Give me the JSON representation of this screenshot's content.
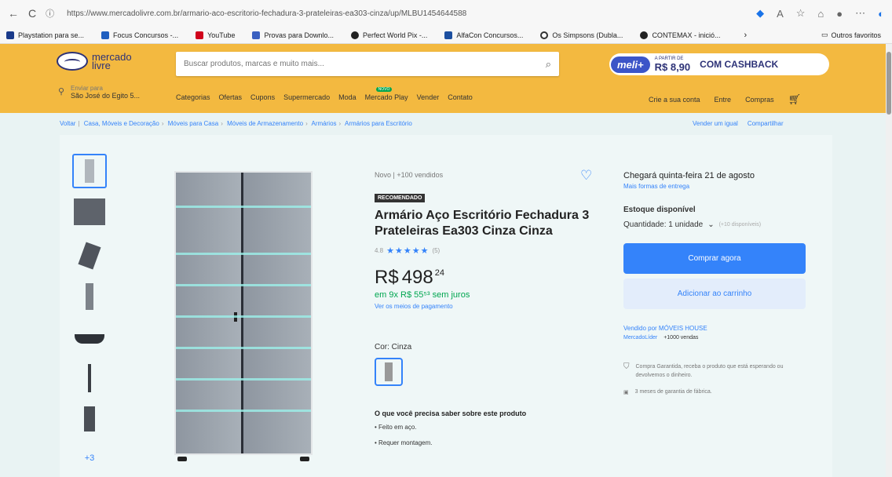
{
  "browser": {
    "url": "https://www.mercadolivre.com.br/armario-aco-escritorio-fechadura-3-prateleiras-ea303-cinza/up/MLBU1454644588",
    "bookmarks": [
      {
        "label": "Playstation para se...",
        "color": "#1a3a8a"
      },
      {
        "label": "Focus Concursos -...",
        "color": "#2060c0"
      },
      {
        "label": "YouTube",
        "color": "#d0021b"
      },
      {
        "label": "Provas para Downlo...",
        "color": "#3a60c0"
      },
      {
        "label": "Perfect World Pix -...",
        "color": "#222222"
      },
      {
        "label": "AlfaCon Concursos...",
        "color": "#1c4fa0"
      },
      {
        "label": "Os Simpsons (Dubla...",
        "color": "#333333"
      },
      {
        "label": "CONTEMAX - inició...",
        "color": "#222222"
      }
    ],
    "others": "Outros favoritos"
  },
  "header": {
    "logo_text": "mercado livre",
    "search_placeholder": "Buscar produtos, marcas e muito mais...",
    "promo": {
      "brand": "meli+",
      "price_label": "A PARTIR DE",
      "price": "R$ 8,90",
      "cashback": "COM CASHBACK"
    },
    "location": {
      "line1": "Enviar para",
      "line2": "São José do Egito 5..."
    },
    "menu": [
      "Categorias",
      "Ofertas",
      "Cupons",
      "Supermercado",
      "Moda",
      "Mercado Play",
      "Vender",
      "Contato"
    ],
    "user_menu": [
      "Crie a sua conta",
      "Entre",
      "Compras"
    ]
  },
  "breadcrumbs": [
    "Voltar",
    "Casa, Móveis e Decoração",
    "Móveis para Casa",
    "Móveis de Armazenamento",
    "Armários",
    "Armários para Escritório"
  ],
  "breadcrumb_right": [
    "Vender um igual",
    "Compartilhar"
  ],
  "product": {
    "condition": "Novo  |  +100 vendidos",
    "badge": "RECOMENDADO",
    "title": "Armário Aço Escritório Fechadura 3 Prateleiras Ea303 Cinza Cinza",
    "rating": "4.8",
    "stars": "★★★★★",
    "reviews": "(5)",
    "price_currency": "R$",
    "price_amount": "498",
    "price_cents": "24",
    "installments": "em 9x R$ 55⁵³ sem juros",
    "payment_link": "Ver os meios de pagamento",
    "color_label": "Cor: Cinza",
    "know_title": "O que você precisa saber sobre este produto",
    "know_items": [
      "Feito em aço.",
      "Requer montagem."
    ]
  },
  "buybox": {
    "shipping": "Chegará quinta-feira 21 de agosto",
    "shipping_sub": "Mais formas de entrega",
    "stock": "Estoque disponível",
    "qty_label": "Quantidade: 1 unidade",
    "qty_more": "(+10 disponíveis)",
    "buy_now": "Comprar agora",
    "add_cart": "Adicionar ao carrinho",
    "seller": "Vendido por MÓVEIS HOUSE",
    "seller_meta": [
      "MercadoLíder",
      "+1000 vendas"
    ],
    "guarantee": "Compra Garantida, receba o produto que está esperando ou devolvemos o dinheiro.",
    "warranty": "3 meses de garantia de fábrica."
  }
}
